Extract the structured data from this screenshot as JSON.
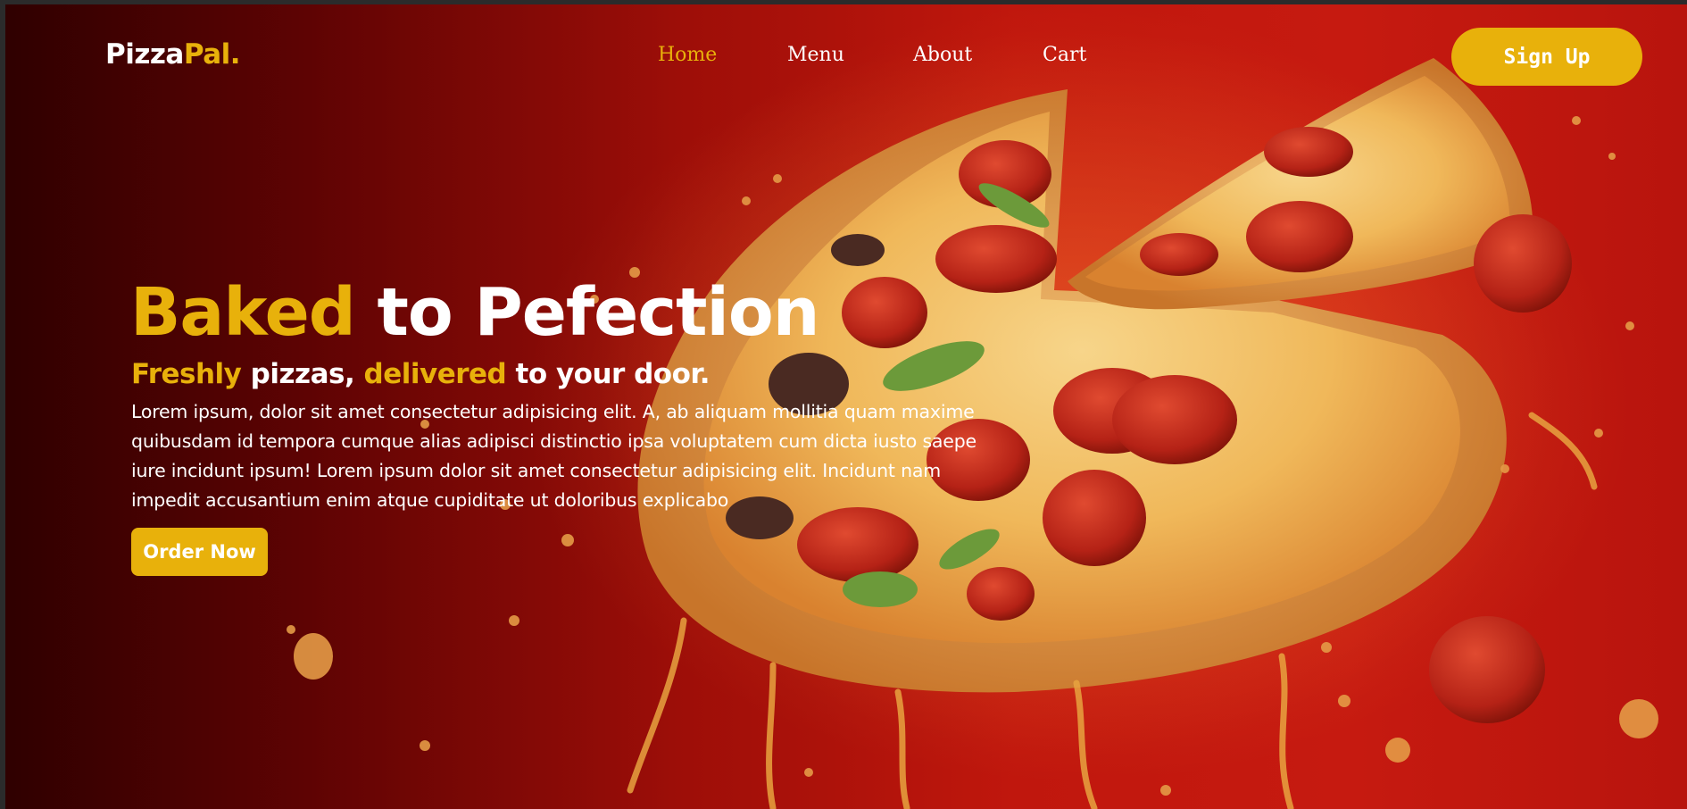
{
  "brand": {
    "part1": "Pizza",
    "part2": "Pal."
  },
  "nav": {
    "items": [
      {
        "label": "Home",
        "active": true
      },
      {
        "label": "Menu",
        "active": false
      },
      {
        "label": "About",
        "active": false
      },
      {
        "label": "Cart",
        "active": false
      }
    ],
    "signup_label": "Sign Up"
  },
  "hero": {
    "title_accent": "Baked",
    "title_rest": "to Pefection",
    "subtitle": {
      "w1": "Freshly",
      "w2": "pizzas,",
      "w3": "delivered",
      "w4": "to your door."
    },
    "body": "Lorem ipsum, dolor sit amet consectetur adipisicing elit. A, ab aliquam mollitia quam maxime quibusdam id tempora cumque alias adipisci distinctio ipsa voluptatem cum dicta iusto saepe iure incidunt ipsum! Lorem ipsum dolor sit amet consectetur adipisicing elit. Incidunt nam impedit accusantium enim atque cupiditate ut doloribus explicabo",
    "cta_label": "Order Now"
  },
  "colors": {
    "accent": "#e8b10b",
    "text": "#ffffff",
    "background_dark": "#2f0000",
    "background_red": "#c61a10"
  },
  "icons": {
    "hero_image": "pizza-illustration"
  }
}
